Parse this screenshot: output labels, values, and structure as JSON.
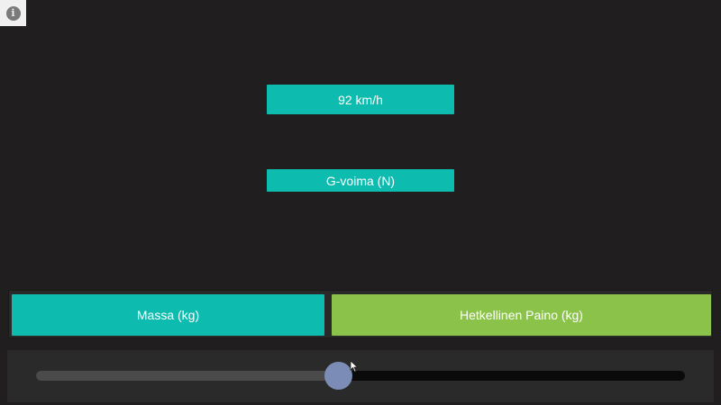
{
  "info": {
    "icon": "info-icon",
    "glyph": "i"
  },
  "speed": {
    "text": "92 km/h"
  },
  "force": {
    "text": "G-voima (N)"
  },
  "modes": {
    "mass_label": "Massa (kg)",
    "weight_label": "Hetkellinen Paino (kg)"
  },
  "slider": {
    "value_fraction": 0.465
  },
  "colors": {
    "background": "#201e1f",
    "display": "#0dbcae",
    "mass_button": "#0dbcae",
    "weight_button": "#8bc34a",
    "thumb": "#7b8db7",
    "track": "#0a0a0a",
    "track_fill": "#4a4a4a"
  }
}
